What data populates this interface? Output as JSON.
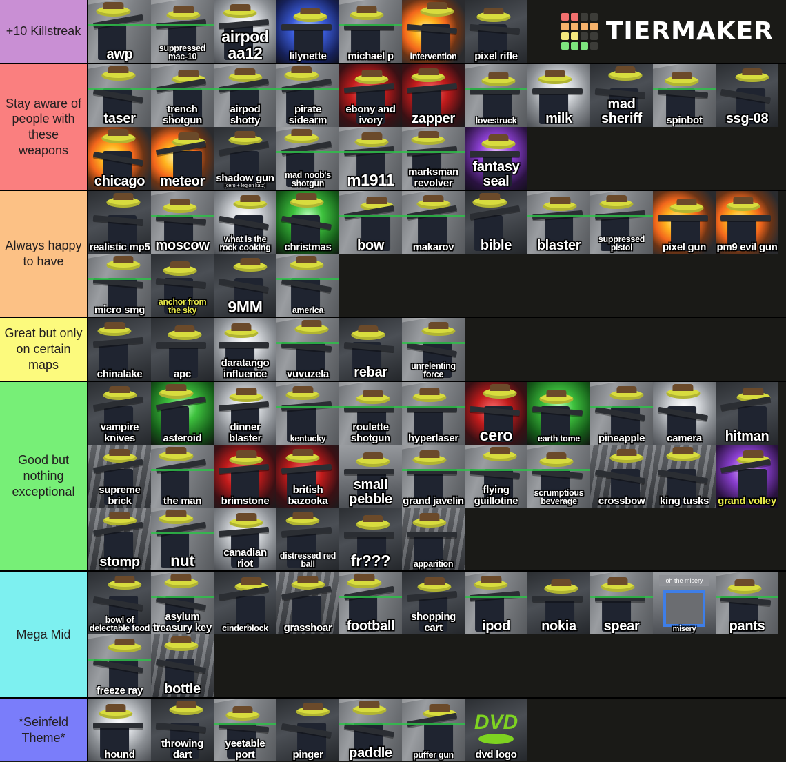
{
  "app": {
    "name": "TierMaker",
    "logo_colors": [
      "#f2706e",
      "#f2706e",
      "#3c3c38",
      "#3c3c38",
      "#f6b26b",
      "#f6b26b",
      "#f6b26b",
      "#f6b26b",
      "#f5e97f",
      "#f5e97f",
      "#3c3c38",
      "#3c3c38",
      "#7ee67e",
      "#7ee67e",
      "#7ee67e",
      "#3c3c38"
    ],
    "background": "#1a1a17"
  },
  "tiers": [
    {
      "label": "+10\nKillstreak",
      "label_line1": "+10",
      "label_line2": "Killstreak",
      "color": "#c98fd4",
      "items": [
        {
          "name": "awp",
          "size": "lg",
          "bg": "bg-hall"
        },
        {
          "name": "suppressed mac-10",
          "size": "sm",
          "bg": "bg-hall"
        },
        {
          "name": "airpod aa12",
          "size": "xl",
          "bg": "bg-light"
        },
        {
          "name": "lilynette",
          "size": "",
          "bg": "bg-blue"
        },
        {
          "name": "michael p",
          "size": "",
          "bg": "bg-hall"
        },
        {
          "name": "intervention",
          "size": "sm",
          "bg": "bg-fire"
        },
        {
          "name": "pixel rifle",
          "size": "",
          "bg": "bg-dark"
        }
      ]
    },
    {
      "label": "Stay aware of people with these weapons",
      "color": "#fa7f7f",
      "items": [
        {
          "name": "taser",
          "size": "lg",
          "bg": "bg-hall"
        },
        {
          "name": "trench shotgun",
          "size": "",
          "bg": "bg-hall"
        },
        {
          "name": "airpod shotty",
          "size": "",
          "bg": "bg-hall"
        },
        {
          "name": "pirate sidearm",
          "size": "",
          "bg": "bg-hall"
        },
        {
          "name": "ebony and ivory",
          "size": "",
          "bg": "bg-red"
        },
        {
          "name": "zapper",
          "size": "lg",
          "bg": "bg-red"
        },
        {
          "name": "lovestruck",
          "size": "sm",
          "bg": "bg-hall"
        },
        {
          "name": "milk",
          "size": "lg",
          "bg": "bg-light"
        },
        {
          "name": "mad sheriff",
          "size": "lg",
          "bg": "bg-dark"
        },
        {
          "name": "spinbot",
          "size": "",
          "bg": "bg-hall"
        },
        {
          "name": "ssg-08",
          "size": "lg",
          "bg": "bg-dark"
        },
        {
          "name": "chicago",
          "size": "lg",
          "bg": "bg-fire"
        },
        {
          "name": "meteor",
          "size": "lg",
          "bg": "bg-fire"
        },
        {
          "name": "shadow gun",
          "sub": "(cero + legion katz)",
          "size": "",
          "bg": "bg-dark"
        },
        {
          "name": "mad noob's shotgun",
          "size": "sm",
          "bg": "bg-hall"
        },
        {
          "name": "m1911",
          "size": "xl",
          "bg": "bg-hall"
        },
        {
          "name": "marksman revolver",
          "size": "",
          "bg": "bg-hall"
        },
        {
          "name": "fantasy seal",
          "size": "lg",
          "bg": "bg-purp"
        }
      ]
    },
    {
      "label": "Always happy to have",
      "color": "#fcc185",
      "items": [
        {
          "name": "realistic mp5",
          "size": "",
          "bg": "bg-dark"
        },
        {
          "name": "moscow",
          "size": "lg",
          "bg": "bg-hall"
        },
        {
          "name": "what is the rock cooking",
          "size": "sm",
          "bg": "bg-light"
        },
        {
          "name": "christmas",
          "size": "",
          "bg": "bg-green"
        },
        {
          "name": "bow",
          "size": "lg",
          "bg": "bg-hall"
        },
        {
          "name": "makarov",
          "size": "",
          "bg": "bg-hall"
        },
        {
          "name": "bible",
          "size": "lg",
          "bg": "bg-dark"
        },
        {
          "name": "blaster",
          "size": "lg",
          "bg": "bg-hall"
        },
        {
          "name": "suppressed pistol",
          "size": "sm",
          "bg": "bg-hall"
        },
        {
          "name": "pixel gun",
          "size": "",
          "bg": "bg-fire"
        },
        {
          "name": "pm9 evil gun",
          "size": "",
          "bg": "bg-fire"
        },
        {
          "name": "micro smg",
          "size": "",
          "bg": "bg-hall"
        },
        {
          "name": "anchor from the sky",
          "size": "sm",
          "color": "yellow",
          "bg": "bg-dark"
        },
        {
          "name": "9MM",
          "size": "xl",
          "bg": "bg-dark"
        },
        {
          "name": "america",
          "size": "sm",
          "bg": "bg-hall"
        }
      ]
    },
    {
      "label": "Great but only on certain maps",
      "color": "#fcfa7d",
      "items": [
        {
          "name": "chinalake",
          "size": "",
          "bg": "bg-dark"
        },
        {
          "name": "apc",
          "size": "",
          "bg": "bg-dark"
        },
        {
          "name": "daratango influence",
          "size": "",
          "bg": "bg-light"
        },
        {
          "name": "vuvuzela",
          "size": "",
          "bg": "bg-hall"
        },
        {
          "name": "rebar",
          "size": "lg",
          "bg": "bg-dark"
        },
        {
          "name": "unrelenting force",
          "size": "sm",
          "bg": "bg-hall"
        }
      ]
    },
    {
      "label": "Good but nothing exceptional",
      "color": "#77ef77",
      "items": [
        {
          "name": "vampire knives",
          "size": "",
          "bg": "bg-dark"
        },
        {
          "name": "asteroid",
          "size": "",
          "bg": "bg-green"
        },
        {
          "name": "dinner blaster",
          "size": "",
          "bg": "bg-light"
        },
        {
          "name": "kentucky",
          "size": "sm",
          "bg": "bg-hall"
        },
        {
          "name": "roulette shotgun",
          "size": "",
          "bg": "bg-hall"
        },
        {
          "name": "hyperlaser",
          "size": "",
          "bg": "bg-hall"
        },
        {
          "name": "cero",
          "size": "xl",
          "bg": "bg-red"
        },
        {
          "name": "earth tome",
          "size": "sm",
          "bg": "bg-green"
        },
        {
          "name": "pineapple",
          "size": "",
          "bg": "bg-hall"
        },
        {
          "name": "camera",
          "size": "",
          "bg": "bg-light"
        },
        {
          "name": "hitman",
          "size": "lg",
          "bg": "bg-dark"
        },
        {
          "name": "supreme brick",
          "size": "",
          "bg": "bg-floor"
        },
        {
          "name": "the man",
          "size": "",
          "bg": "bg-hall"
        },
        {
          "name": "brimstone",
          "size": "",
          "bg": "bg-red"
        },
        {
          "name": "british bazooka",
          "size": "",
          "bg": "bg-red"
        },
        {
          "name": "small pebble",
          "size": "lg",
          "bg": "bg-gray"
        },
        {
          "name": "grand javelin",
          "size": "",
          "bg": "bg-hall"
        },
        {
          "name": "flying guillotine",
          "size": "",
          "bg": "bg-hall"
        },
        {
          "name": "scrumptious beverage",
          "size": "sm",
          "bg": "bg-hall"
        },
        {
          "name": "crossbow",
          "size": "",
          "bg": "bg-floor"
        },
        {
          "name": "king tusks",
          "size": "",
          "bg": "bg-floor"
        },
        {
          "name": "grand volley",
          "size": "",
          "color": "yellow",
          "bg": "bg-purp"
        },
        {
          "name": "stomp",
          "size": "lg",
          "bg": "bg-floor"
        },
        {
          "name": "nut",
          "size": "xl",
          "bg": "bg-hall"
        },
        {
          "name": "canadian riot",
          "size": "",
          "bg": "bg-light"
        },
        {
          "name": "distressed red ball",
          "size": "sm",
          "bg": "bg-dark"
        },
        {
          "name": "fr???",
          "size": "xl",
          "bg": "bg-dark"
        },
        {
          "name": "apparition",
          "size": "sm",
          "bg": "bg-floor"
        }
      ]
    },
    {
      "label": "Mega Mid",
      "color": "#7df0f0",
      "items": [
        {
          "name": "bowl of delectable food",
          "size": "sm",
          "bg": "bg-dark"
        },
        {
          "name": "asylum treasury key",
          "size": "",
          "bg": "bg-hall"
        },
        {
          "name": "cinderblock",
          "size": "sm",
          "bg": "bg-dark"
        },
        {
          "name": "grasshoar",
          "size": "",
          "bg": "bg-floor"
        },
        {
          "name": "football",
          "size": "lg",
          "bg": "bg-hall"
        },
        {
          "name": "shopping cart",
          "size": "",
          "bg": "bg-dark"
        },
        {
          "name": "ipod",
          "size": "lg",
          "bg": "bg-hall"
        },
        {
          "name": "nokia",
          "size": "lg",
          "bg": "bg-dark"
        },
        {
          "name": "spear",
          "size": "lg",
          "bg": "bg-hall"
        },
        {
          "name": "misery",
          "caption_top": "oh the misery",
          "size": "xs",
          "bg": "bg-gray",
          "special": "misery"
        },
        {
          "name": "pants",
          "size": "lg",
          "bg": "bg-hall"
        },
        {
          "name": "freeze ray",
          "size": "",
          "bg": "bg-hall"
        },
        {
          "name": "bottle",
          "size": "lg",
          "bg": "bg-floor"
        }
      ]
    },
    {
      "label": "*Seinfeld Theme*",
      "color": "#7a7dfa",
      "items": [
        {
          "name": "hound",
          "size": "",
          "bg": "bg-light"
        },
        {
          "name": "throwing dart",
          "size": "",
          "bg": "bg-dark"
        },
        {
          "name": "yeetable port",
          "size": "",
          "bg": "bg-hall"
        },
        {
          "name": "pinger",
          "size": "",
          "bg": "bg-dark"
        },
        {
          "name": "paddle",
          "size": "lg",
          "bg": "bg-hall"
        },
        {
          "name": "puffer gun",
          "size": "sm",
          "bg": "bg-hall"
        },
        {
          "name": "dvd logo",
          "size": "",
          "bg": "bg-dark",
          "special": "dvd"
        }
      ]
    }
  ]
}
